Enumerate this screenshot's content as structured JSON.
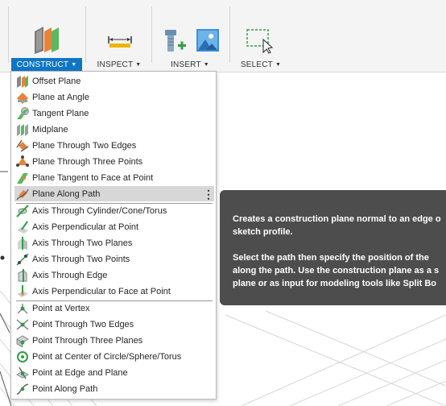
{
  "toolbar": {
    "groups": [
      {
        "label": "CONSTRUCT",
        "icon": "offset-plane-icon",
        "active": true
      },
      {
        "label": "INSPECT",
        "icon": "measure-icon",
        "active": false
      },
      {
        "label": "INSERT",
        "icon": "insert-icon",
        "active": false
      },
      {
        "label": "SELECT",
        "icon": "select-icon",
        "active": false
      }
    ]
  },
  "menu": {
    "sections": [
      [
        {
          "label": "Offset Plane",
          "icon": "offset-plane-icon"
        },
        {
          "label": "Plane at Angle",
          "icon": "plane-at-angle-icon"
        },
        {
          "label": "Tangent Plane",
          "icon": "tangent-plane-icon"
        },
        {
          "label": "Midplane",
          "icon": "midplane-icon"
        },
        {
          "label": "Plane Through Two Edges",
          "icon": "plane-two-edges-icon"
        },
        {
          "label": "Plane Through Three Points",
          "icon": "plane-three-points-icon"
        },
        {
          "label": "Plane Tangent to Face at Point",
          "icon": "plane-tangent-face-icon"
        },
        {
          "label": "Plane Along Path",
          "icon": "plane-along-path-icon",
          "highlighted": true
        }
      ],
      [
        {
          "label": "Axis Through Cylinder/Cone/Torus",
          "icon": "axis-cylinder-icon"
        },
        {
          "label": "Axis Perpendicular at Point",
          "icon": "axis-perpendicular-point-icon"
        },
        {
          "label": "Axis Through Two Planes",
          "icon": "axis-two-planes-icon"
        },
        {
          "label": "Axis Through Two Points",
          "icon": "axis-two-points-icon"
        },
        {
          "label": "Axis Through Edge",
          "icon": "axis-edge-icon"
        },
        {
          "label": "Axis Perpendicular to Face at Point",
          "icon": "axis-perpendicular-face-icon"
        }
      ],
      [
        {
          "label": "Point at Vertex",
          "icon": "point-vertex-icon"
        },
        {
          "label": "Point Through Two Edges",
          "icon": "point-two-edges-icon"
        },
        {
          "label": "Point Through Three Planes",
          "icon": "point-three-planes-icon"
        },
        {
          "label": "Point at Center of Circle/Sphere/Torus",
          "icon": "point-center-icon"
        },
        {
          "label": "Point at Edge and Plane",
          "icon": "point-edge-plane-icon"
        },
        {
          "label": "Point Along Path",
          "icon": "point-along-path-icon"
        }
      ]
    ]
  },
  "tooltip": {
    "line1": "Creates a construction plane normal to an edge o",
    "line2": "sketch profile.",
    "line3": "Select the path then specify the position of the",
    "line4": "along the path. Use the construction plane as a s",
    "line5": "plane or as input for modeling tools like Split Bo"
  },
  "colors": {
    "accent": "#0f76c6",
    "tooltip_bg": "#4d4d4d",
    "highlight": "#d7d7d7",
    "icon_green": "#5cb85c",
    "icon_orange": "#e8833a"
  }
}
